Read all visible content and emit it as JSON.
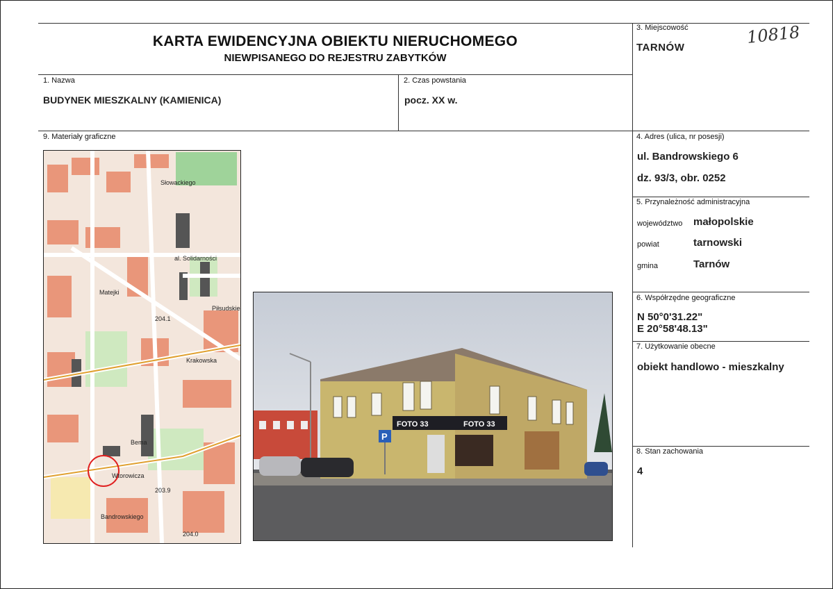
{
  "header": {
    "title": "KARTA EWIDENCYJNA OBIEKTU NIERUCHOMEGO",
    "subtitle": "NIEWPISANEGO DO REJESTRU ZABYTKÓW",
    "catalog_number": "10818"
  },
  "fields": {
    "miejscowosc": {
      "label": "3. Miejscowość",
      "value": "TARNÓW"
    },
    "nazwa": {
      "label": "1. Nazwa",
      "value": "BUDYNEK MIESZKALNY (KAMIENICA)"
    },
    "czas": {
      "label": "2. Czas powstania",
      "value": "pocz. XX w."
    },
    "materialy": {
      "label": "9. Materiały graficzne"
    },
    "adres": {
      "label": "4. Adres (ulica, nr posesji)",
      "line1": "ul. Bandrowskiego 6",
      "line2": "dz. 93/3, obr. 0252"
    },
    "przynaleznosc": {
      "label": "5. Przynależność administracyjna",
      "wojewodztwo_label": "województwo",
      "wojewodztwo": "małopolskie",
      "powiat_label": "powiat",
      "powiat": "tarnowski",
      "gmina_label": "gmina",
      "gmina": "Tarnów"
    },
    "wspolrzedne": {
      "label": "6. Współrzędne geograficzne",
      "n": "N 50°0'31.22\"",
      "e": "E 20°58'48.13\""
    },
    "uzytkowanie": {
      "label": "7. Użytkowanie obecne",
      "value": "obiekt handlowo - mieszkalny"
    },
    "stan": {
      "label": "8. Stan zachowania",
      "value": "4"
    }
  },
  "map_labels": {
    "slowackiego": "Słowackiego",
    "solidarnosci": "al. Solidarności",
    "krakowska": "Krakowska",
    "bema": "Bema",
    "matejki": "Matejki",
    "pilsudskiego": "Piłsudskiego",
    "wtorowicza": "Wtorowicza",
    "bandrowskiego": "Bandrowskiego",
    "elev1": "204.1",
    "elev2": "203.9",
    "elev3": "204.0"
  },
  "photo_signs": {
    "foto1": "FOTO 33",
    "foto2": "FOTO 33",
    "parking": "P"
  }
}
